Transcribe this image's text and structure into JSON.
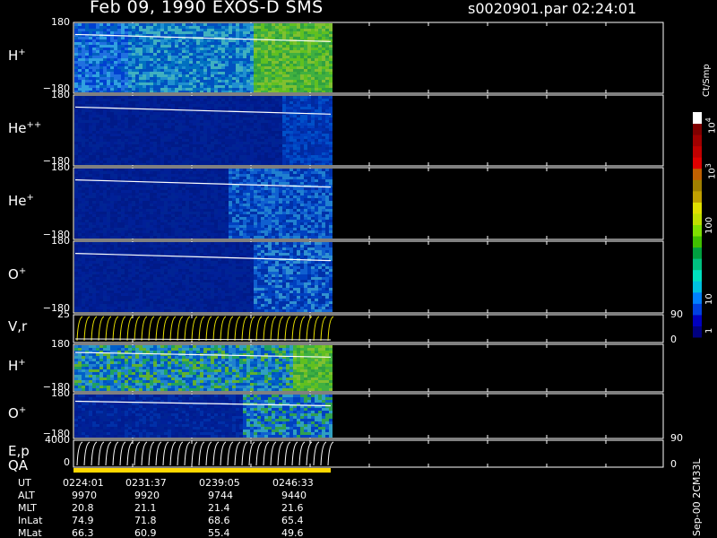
{
  "header": {
    "title": "Feb 09, 1990   EXOS-D SMS",
    "file": "s0020901.par  02:24:01"
  },
  "panels": [
    {
      "label_main": "H",
      "label_sup": "+",
      "top_tick": "180",
      "bottom_tick": "-180",
      "kind": "spec",
      "bg": "H"
    },
    {
      "label_main": "He",
      "label_sup": "++",
      "top_tick": "180",
      "bottom_tick": "-180",
      "kind": "spec",
      "bg": "HE2"
    },
    {
      "label_main": "He",
      "label_sup": "+",
      "top_tick": "180",
      "bottom_tick": "-180",
      "kind": "spec",
      "bg": "HE1"
    },
    {
      "label_main": "O",
      "label_sup": "+",
      "top_tick": "180",
      "bottom_tick": "-180",
      "kind": "spec",
      "bg": "O"
    },
    {
      "label_main": "V,r",
      "label_sup": "",
      "top_tick": "25",
      "bottom_tick": "",
      "kind": "vr"
    },
    {
      "label_main": "H",
      "label_sup": "+",
      "top_tick": "180",
      "bottom_tick": "-180",
      "kind": "spec",
      "bg": "H2"
    },
    {
      "label_main": "O",
      "label_sup": "+",
      "top_tick": "180",
      "bottom_tick": "-180",
      "kind": "spec",
      "bg": "O2"
    },
    {
      "label_main": "E,p",
      "label_sup": "",
      "top_tick": "4000",
      "bottom_tick": "0",
      "kind": "ep"
    }
  ],
  "qa_label": "QA",
  "right_ticks": {
    "vr_top": "90",
    "vr_bottom": "0",
    "ep_top": "90",
    "ep_bottom": "0"
  },
  "colorbar": {
    "unit": "Ct/Smp",
    "ticks": [
      "1",
      "10",
      "100",
      "10",
      "10"
    ],
    "tick_exponents": [
      "",
      "",
      "",
      "3",
      "4"
    ],
    "colors": [
      "#000080",
      "#0000c0",
      "#0040e0",
      "#0080ff",
      "#00c0e0",
      "#00e0c0",
      "#00c080",
      "#00a040",
      "#40c000",
      "#80e000",
      "#c0e000",
      "#e0e000",
      "#c0a000",
      "#a08000",
      "#c06000",
      "#e00000",
      "#c00000",
      "#a00000",
      "#800000",
      "#ffffff"
    ]
  },
  "footer_right": "Sep-00 2CM33L",
  "table": {
    "row_labels": [
      "UT",
      "ALT",
      "MLT",
      "InLat",
      "MLat"
    ],
    "columns": [
      [
        "0224:01",
        "9970",
        "20.8",
        "74.9",
        "66.3"
      ],
      [
        "0231:37",
        "9920",
        "21.1",
        "71.8",
        "60.9"
      ],
      [
        "0239:05",
        "9744",
        "21.4",
        "68.6",
        "55.4"
      ],
      [
        "0246:33",
        "9440",
        "21.6",
        "65.4",
        "49.6"
      ]
    ]
  },
  "chart_data": {
    "type": "heatmap",
    "title": "Feb 09, 1990   EXOS-D SMS",
    "x_ticks": [
      "0224:01",
      "0231:37",
      "0239:05",
      "0246:33"
    ],
    "y_range_pitch": [
      -180,
      180
    ],
    "colorscale_log_counts": [
      1,
      10000
    ]
  }
}
